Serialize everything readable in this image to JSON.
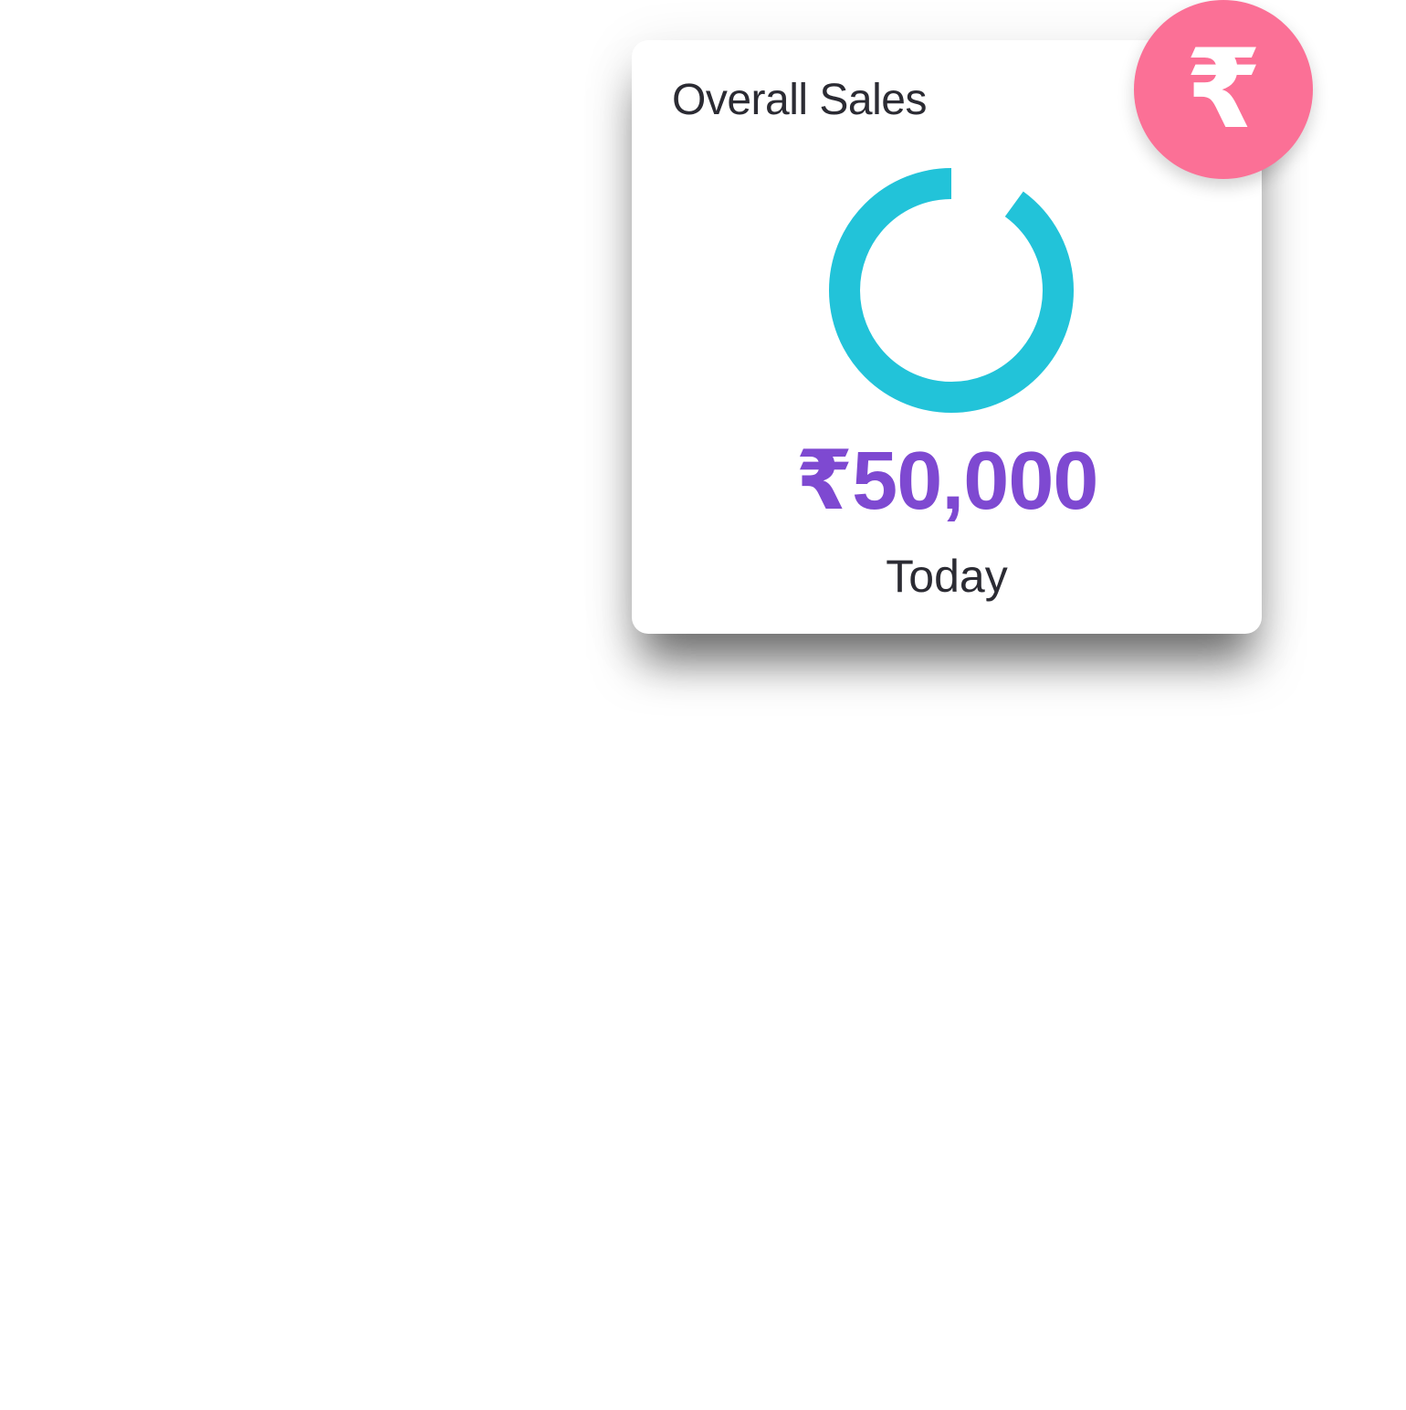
{
  "card": {
    "title": "Overall Sales",
    "amount": "₹50,000",
    "period": "Today",
    "badge_glyph": "₹",
    "badge_icon": "rupee-icon",
    "progress_fraction": 0.9
  },
  "colors": {
    "badge": "#fb7096",
    "ring": "#22c3d9",
    "amount": "#7e49d1",
    "text": "#2b2b33"
  }
}
